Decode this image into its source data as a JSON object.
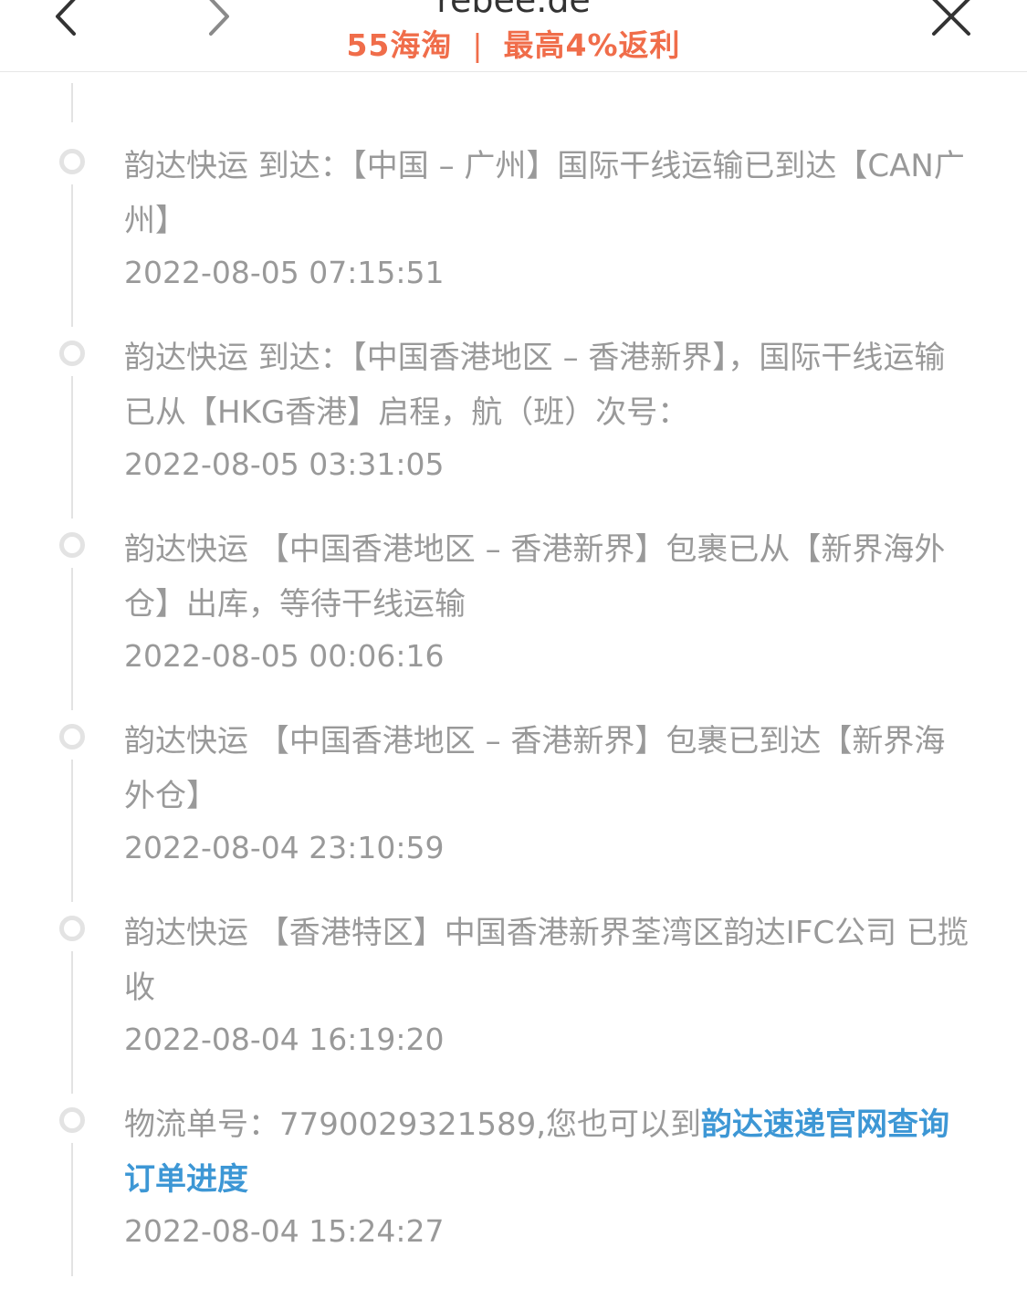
{
  "header": {
    "domain": "rebee.de",
    "promo_left": "55海淘",
    "promo_separator": "|",
    "promo_right": "最高4%返利",
    "back_icon": "chevron-left-icon",
    "forward_icon": "chevron-right-icon",
    "close_icon": "close-icon",
    "promo_color": "#f06d4a"
  },
  "timeline": {
    "line_color": "#e3e3e3",
    "link_color": "#3d97d5",
    "items": [
      {
        "text": "韵达快运 到达：【中国 – 广州】国际干线运输已到达【CAN广州】",
        "time": "2022-08-05 07:15:51"
      },
      {
        "text": "韵达快运 到达：【中国香港地区 – 香港新界】，国际干线运输已从【HKG香港】启程，航（班）次号：",
        "time": "2022-08-05 03:31:05"
      },
      {
        "text": "韵达快运 【中国香港地区 – 香港新界】包裹已从【新界海外仓】出库，等待干线运输",
        "time": "2022-08-05 00:06:16"
      },
      {
        "text": "韵达快运 【中国香港地区 – 香港新界】包裹已到达【新界海外仓】",
        "time": "2022-08-04 23:10:59"
      },
      {
        "text": "韵达快运 【香港特区】中国香港新界荃湾区韵达IFC公司 已揽收",
        "time": "2022-08-04 16:19:20"
      },
      {
        "text_prefix": "物流单号：7790029321589,您也可以到",
        "link_text": "韵达速递官网查询订单进度",
        "time": "2022-08-04 15:24:27"
      }
    ]
  }
}
